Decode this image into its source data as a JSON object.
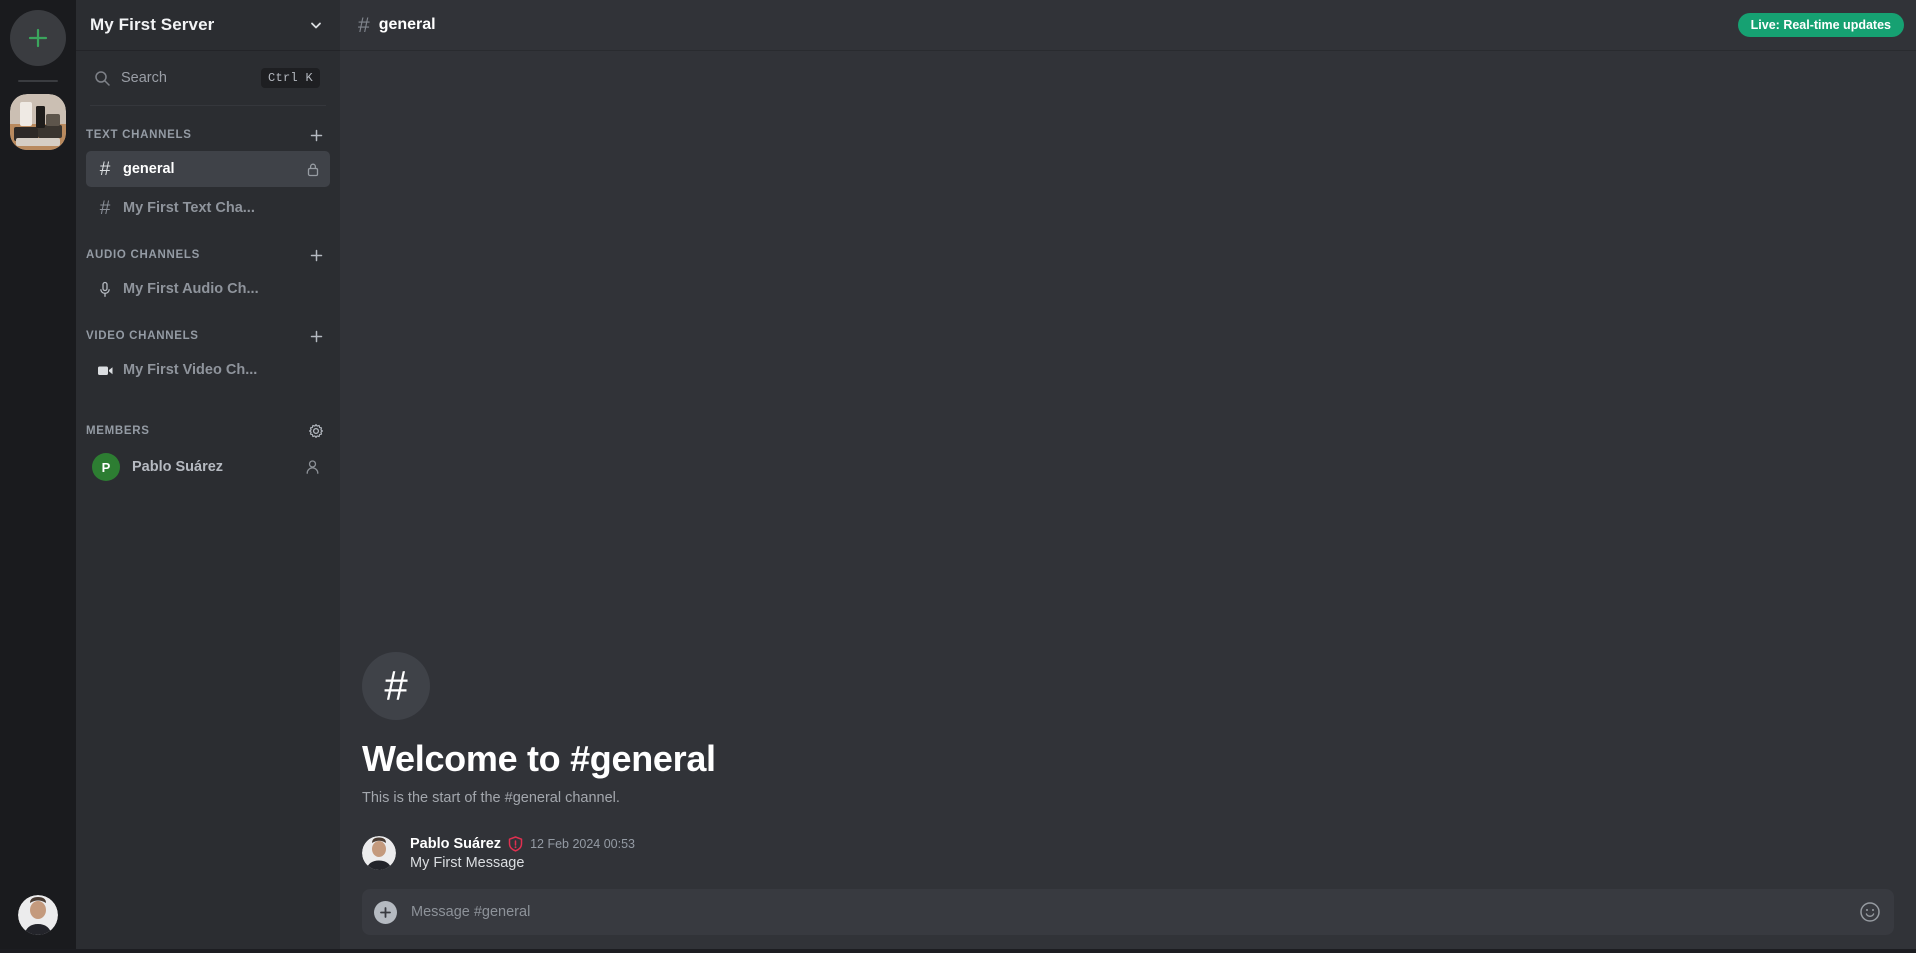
{
  "rail": {
    "add_server_label": "+",
    "add_server_icon": "plus-icon",
    "server_icon": "server-thumbnail",
    "user_avatar": "user-avatar",
    "accent_green": "#3ba55d"
  },
  "sidebar": {
    "server_name": "My First Server",
    "chevron_icon": "chevron-down-icon",
    "search": {
      "icon": "search-icon",
      "label": "Search",
      "shortcut": "Ctrl K"
    },
    "categories": [
      {
        "label": "TEXT CHANNELS",
        "add_icon": "plus-icon",
        "channels": [
          {
            "name": "general",
            "icon": "hash-icon",
            "active": true,
            "right_icon": "lock-icon"
          },
          {
            "name": "My First Text Cha...",
            "icon": "hash-icon",
            "active": false,
            "right_icon": ""
          }
        ]
      },
      {
        "label": "AUDIO CHANNELS",
        "add_icon": "plus-icon",
        "channels": [
          {
            "name": "My First Audio Ch...",
            "icon": "microphone-icon",
            "active": false,
            "right_icon": ""
          }
        ]
      },
      {
        "label": "VIDEO CHANNELS",
        "add_icon": "plus-icon",
        "channels": [
          {
            "name": "My First Video Ch...",
            "icon": "video-camera-icon",
            "active": false,
            "right_icon": ""
          }
        ]
      }
    ],
    "members": {
      "label": "MEMBERS",
      "settings_icon": "gear-icon",
      "list": [
        {
          "name": "Pablo Suárez",
          "initial": "P",
          "avatar_color": "#2d7d32",
          "right_icon": "person-icon"
        }
      ]
    }
  },
  "main": {
    "header": {
      "hash": "#",
      "channel": "general",
      "live_badge": "Live: Real-time updates",
      "live_badge_color": "#16a172"
    },
    "welcome": {
      "hash": "#",
      "title": "Welcome to #general",
      "subtitle": "This is the start of the #general channel."
    },
    "messages": [
      {
        "author": "Pablo Suárez",
        "badge_icon": "shield-alert-icon",
        "badge_color": "#e03050",
        "timestamp": "12 Feb 2024 00:53",
        "text": "My First Message",
        "avatar": "user-avatar"
      }
    ],
    "composer": {
      "add_icon": "plus-icon",
      "placeholder": "Message #general",
      "value": "",
      "emoji_icon": "emoji-smiley-icon"
    }
  }
}
